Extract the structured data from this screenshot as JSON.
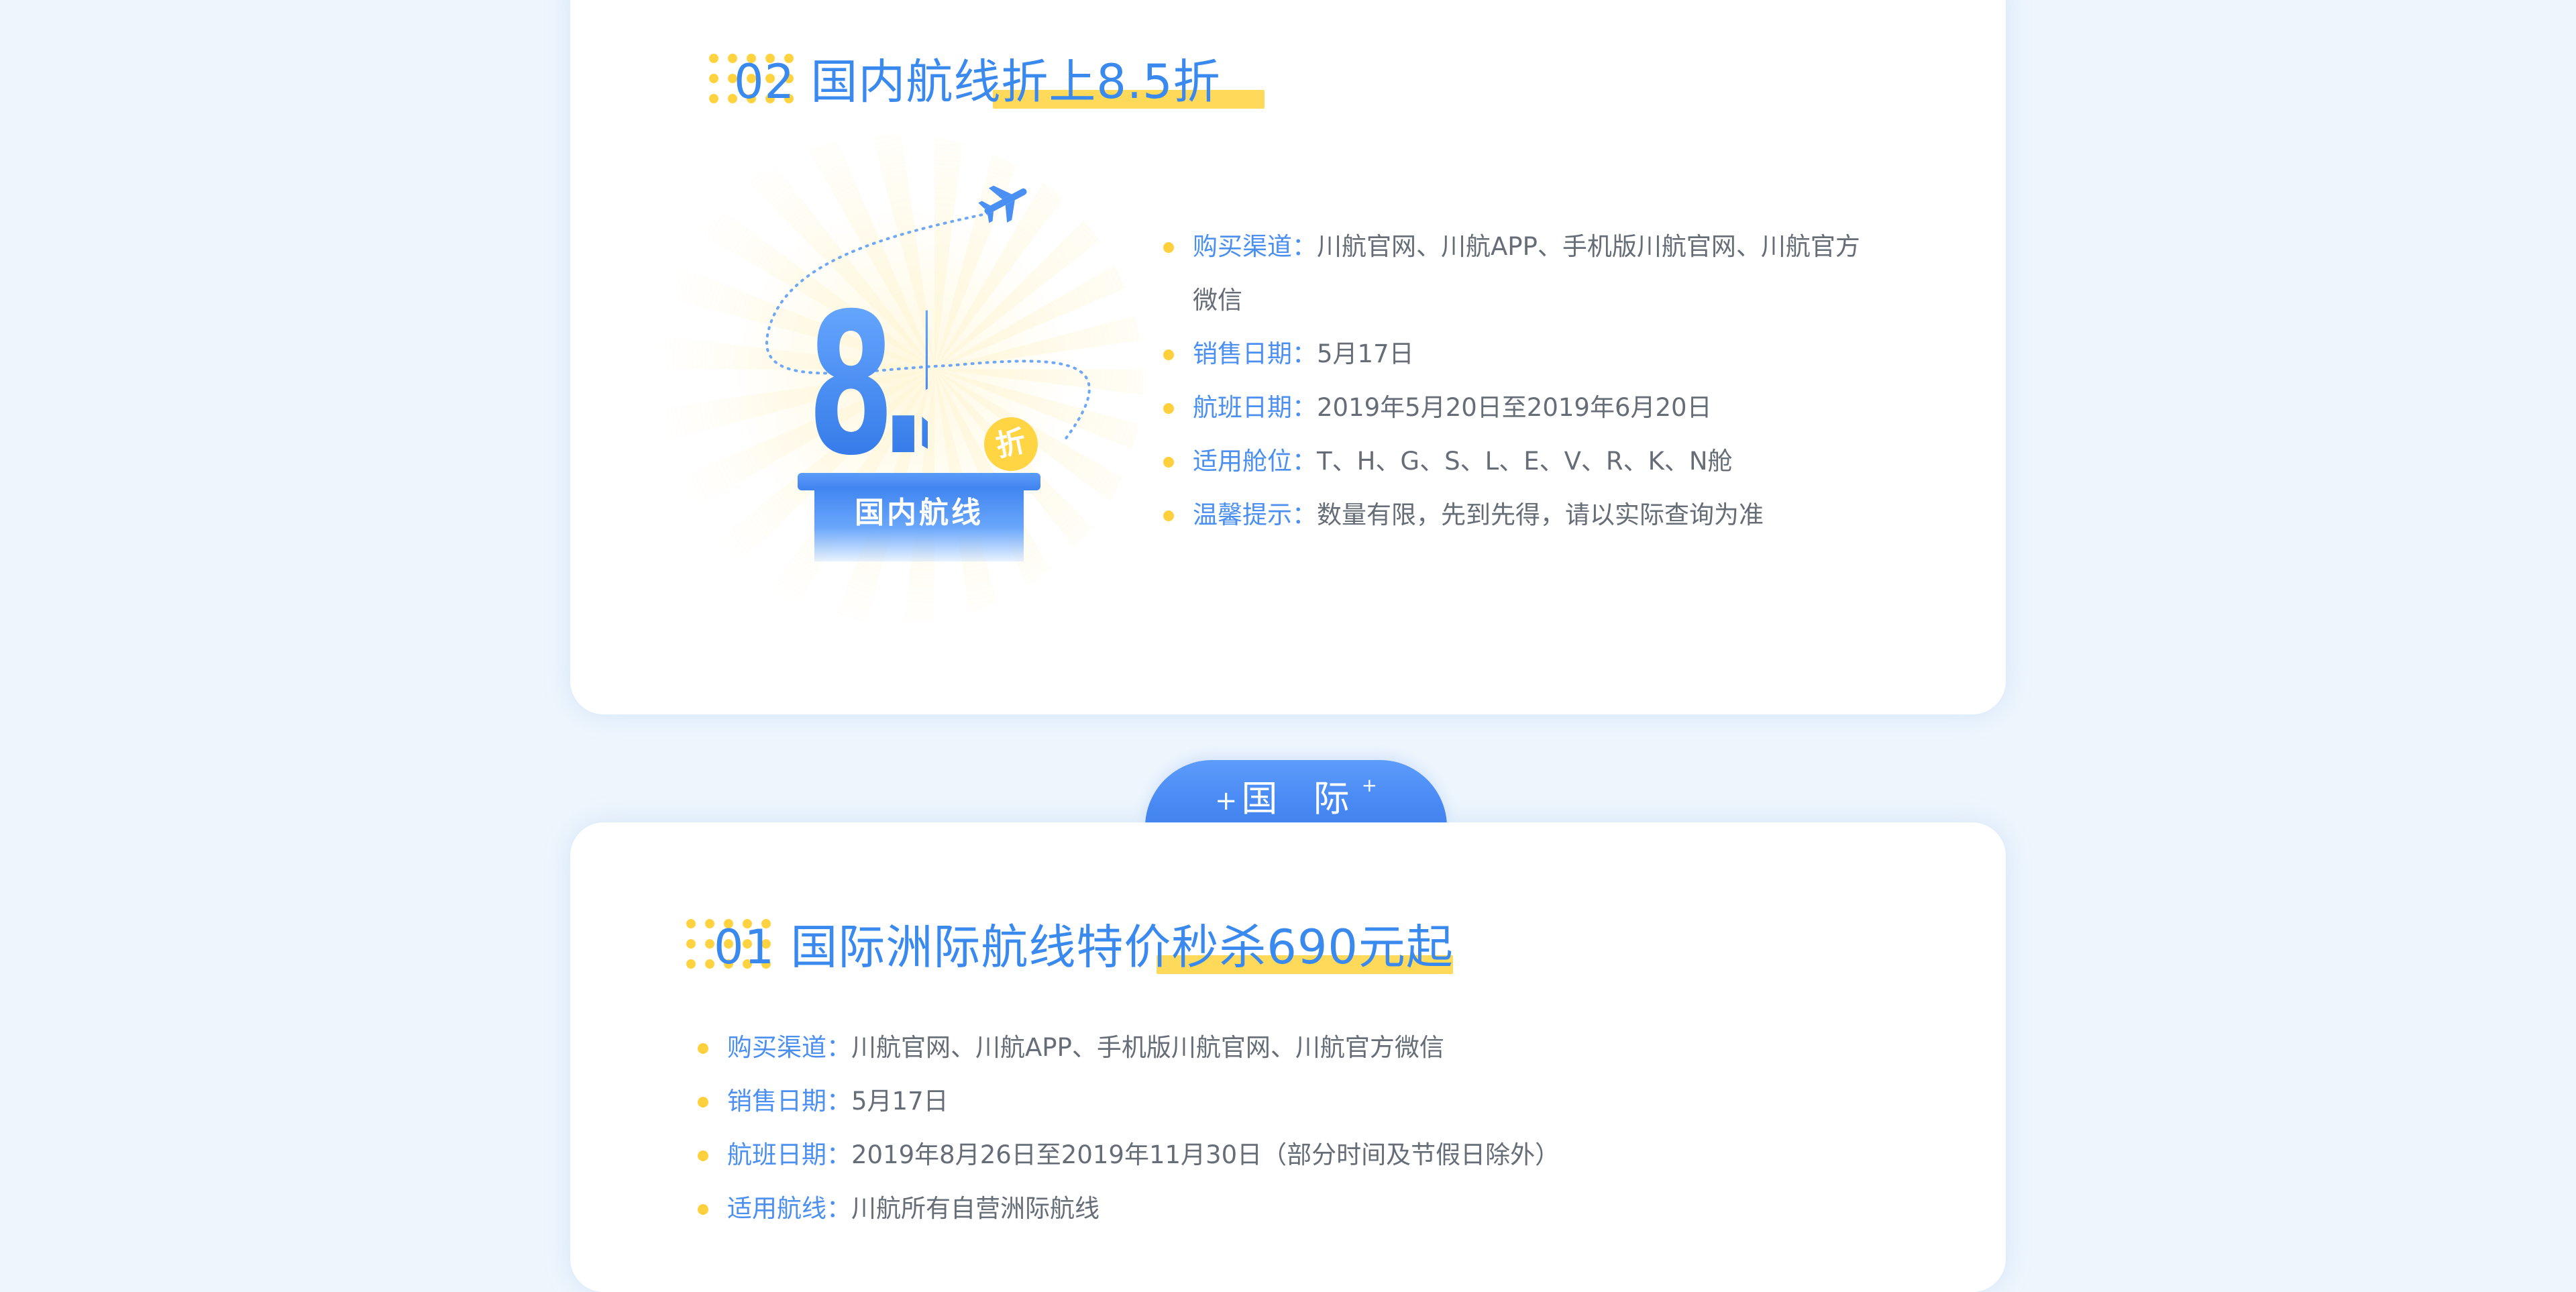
{
  "domestic": {
    "heading": "02 国内航线折上8.5折",
    "badge": {
      "number": "8.5",
      "discount_char": "折",
      "caption": "国内航线"
    },
    "details": [
      {
        "label": "购买渠道：",
        "value": "川航官网、川航APP、手机版川航官网、川航官方",
        "value_cont": "微信"
      },
      {
        "label": "销售日期：",
        "value": "5月17日"
      },
      {
        "label": "航班日期：",
        "value": "2019年5月20日至2019年6月20日"
      },
      {
        "label": "适用舱位：",
        "value": "T、H、G、S、L、E、V、R、K、N舱"
      },
      {
        "label": "温馨提示：",
        "value": "数量有限，先到先得，请以实际查询为准"
      }
    ]
  },
  "international_tab": {
    "plus": "+",
    "label": "国 际",
    "plus_sup": "+"
  },
  "international": {
    "heading": "01 国际洲际航线特价秒杀690元起",
    "details": [
      {
        "label": "购买渠道：",
        "value": "川航官网、川航APP、手机版川航官网、川航官方微信"
      },
      {
        "label": "销售日期：",
        "value": "5月17日"
      },
      {
        "label": "航班日期：",
        "value": "2019年8月26日至2019年11月30日（部分时间及节假日除外）"
      },
      {
        "label": "适用航线：",
        "value": "川航所有自营洲际航线"
      }
    ]
  },
  "colors": {
    "accent_blue": "#3a89ee",
    "highlight_yellow": "#ffd95a",
    "bullet_yellow": "#ffd03d",
    "body_text": "#666d77",
    "background": "#eef6fd"
  },
  "icons": [
    "airplane-icon",
    "dot-grid-decoration",
    "bullet-dot"
  ]
}
